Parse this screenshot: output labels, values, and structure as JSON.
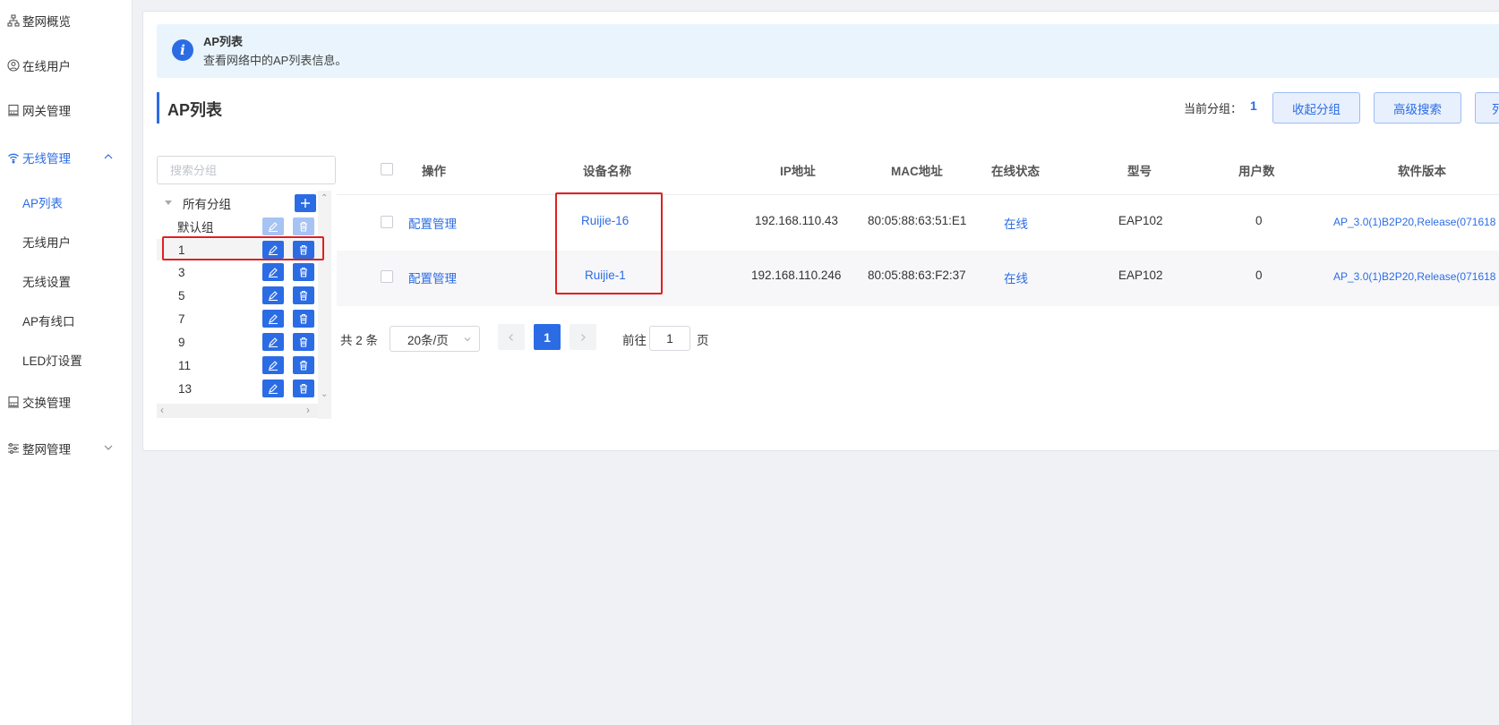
{
  "sidebar": {
    "items": [
      {
        "label": "整网概览",
        "icon": "topology-icon"
      },
      {
        "label": "在线用户",
        "icon": "user-icon"
      },
      {
        "label": "网关管理",
        "icon": "gateway-icon"
      },
      {
        "label": "无线管理",
        "icon": "wifi-icon"
      },
      {
        "label": "交换管理",
        "icon": "switch-icon"
      },
      {
        "label": "整网管理",
        "icon": "network-manage-icon"
      }
    ],
    "wireless_sub": [
      {
        "label": "AP列表"
      },
      {
        "label": "无线用户"
      },
      {
        "label": "无线设置"
      },
      {
        "label": "AP有线口"
      },
      {
        "label": "LED灯设置"
      }
    ]
  },
  "notice": {
    "title": "AP列表",
    "description": "查看网络中的AP列表信息。"
  },
  "section_title": "AP列表",
  "toolbar": {
    "current_group_label": "当前分组：",
    "current_group_value": "1",
    "collapse_button": "收起分组",
    "advanced_search_button": "高级搜索",
    "third_button": "列"
  },
  "group_tree": {
    "search_placeholder": "搜索分组",
    "root_label": "所有分组",
    "groups": [
      "默认组",
      "1",
      "3",
      "5",
      "7",
      "9",
      "11",
      "13"
    ]
  },
  "table": {
    "headers": {
      "action": "操作",
      "device_name": "设备名称",
      "ip": "IP地址",
      "mac": "MAC地址",
      "status": "在线状态",
      "model": "型号",
      "users": "用户数",
      "software": "软件版本"
    },
    "rows": [
      {
        "action": "配置管理",
        "device_name": "Ruijie-16",
        "ip": "192.168.110.43",
        "mac": "80:05:88:63:51:E1",
        "status": "在线",
        "model": "EAP102",
        "users": "0",
        "software": "AP_3.0(1)B2P20,Release(071618"
      },
      {
        "action": "配置管理",
        "device_name": "Ruijie-1",
        "ip": "192.168.110.246",
        "mac": "80:05:88:63:F2:37",
        "status": "在线",
        "model": "EAP102",
        "users": "0",
        "software": "AP_3.0(1)B2P20,Release(071618"
      }
    ]
  },
  "pagination": {
    "total": "共 2 条",
    "page_size": "20条/页",
    "current_page": "1",
    "goto_label": "前往",
    "goto_value": "1",
    "page_suffix": "页"
  },
  "colors": {
    "accent": "#2b6ce5",
    "highlight_box": "#e02020"
  }
}
